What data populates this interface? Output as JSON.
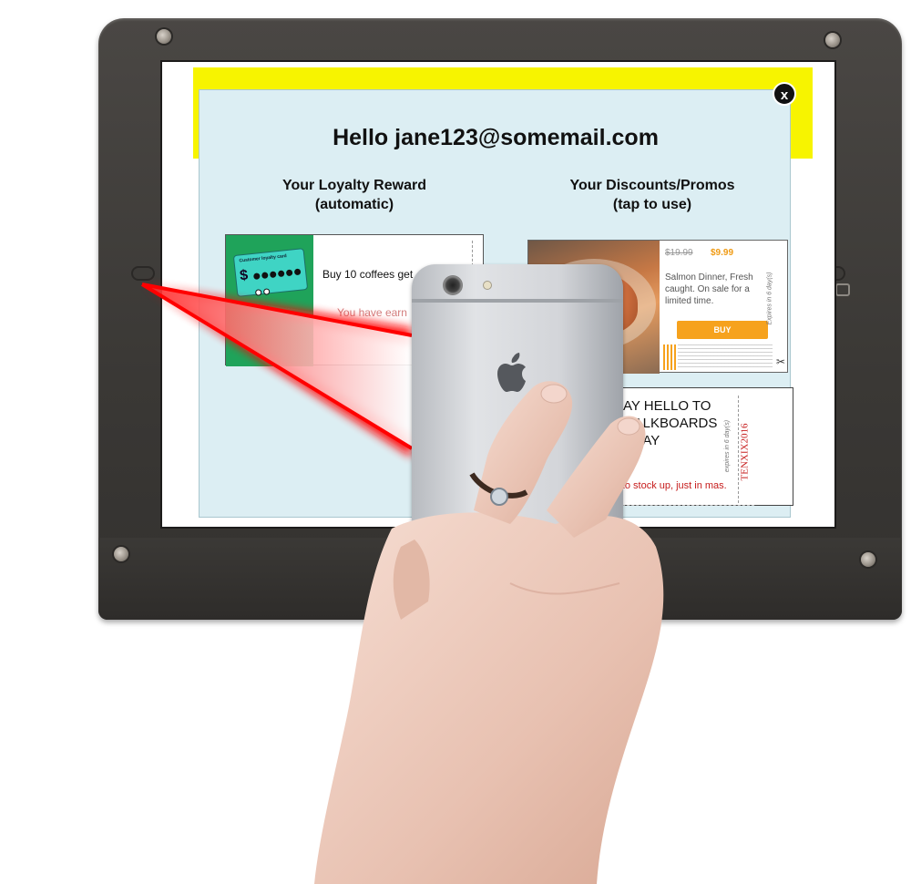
{
  "modal": {
    "close_label": "x",
    "greeting": "Hello jane123@somemail.com",
    "loyalty_title": "Your Loyalty Reward\n(automatic)",
    "promos_title": "Your Discounts/Promos\n(tap to use)"
  },
  "loyalty_card": {
    "graphic_title": "Customer loyalty card",
    "currency_symbol": "$",
    "stamps_filled": 6,
    "stamps_total": 8,
    "text": "Buy 10 coffees get",
    "earned_text": "You have earn"
  },
  "promo1": {
    "old_price": "$19.99",
    "new_price": "$9.99",
    "description": "Salmon Dinner, Fresh caught. On sale for a limited time.",
    "buy_label": "BUY",
    "expires": "Expires in 6 day(s)"
  },
  "promo2": {
    "title": "SAY HELLO TO CHALKBOARDS TODAY",
    "body": "nce to stock up, just in mas.",
    "code": "TENXIX2016",
    "expires": "expires in 6 day(s)"
  },
  "colors": {
    "modal_bg": "#dceef3",
    "header_band": "#f7f400",
    "buy_button": "#f6a21d",
    "laser": "#ff0000",
    "promo_code": "#c61c1c"
  },
  "icons": [
    "close-icon",
    "apple-logo-icon",
    "scissors-icon",
    "phone-camera-icon"
  ]
}
